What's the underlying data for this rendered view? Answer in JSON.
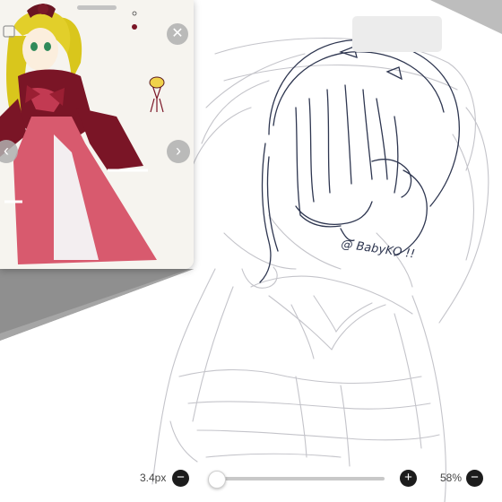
{
  "reference": {
    "close_icon": "close-icon",
    "prev_icon": "chevron-left-icon",
    "next_icon": "chevron-right-icon"
  },
  "canvas": {
    "signature": "@ BabyKO !!"
  },
  "brush": {
    "size_label": "3.4px",
    "size_value": 0.04,
    "minus_icon": "minus-icon",
    "plus_icon": "plus-icon"
  },
  "zoom": {
    "label": "58%",
    "minus_icon": "minus-icon"
  },
  "colors": {
    "slider_fill": "#1e88ff",
    "ink": "#2c3550",
    "pencil": "#b9b9bf"
  }
}
